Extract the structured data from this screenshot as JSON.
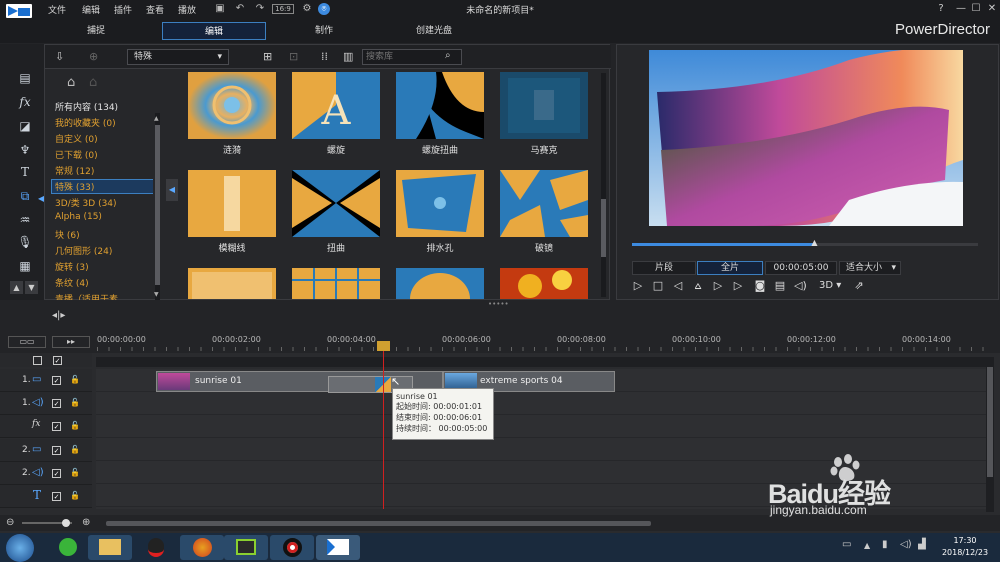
{
  "menu": {
    "items": [
      "文件",
      "编辑",
      "插件",
      "查看",
      "播放"
    ]
  },
  "window": {
    "title": "未命名的新项目*",
    "brand": "PowerDirector",
    "help": "?",
    "minimize": "—",
    "maximize": "☐",
    "close": "✕"
  },
  "mode_tabs": [
    "捕捉",
    "编辑",
    "制作",
    "创建光盘"
  ],
  "library": {
    "dropdown": "特殊",
    "search_placeholder": "搜索库",
    "categories": [
      {
        "label": "所有内容 (134)",
        "color": "white"
      },
      {
        "label": "我的收藏夹 (0)",
        "color": "orange"
      },
      {
        "label": "自定义 (0)",
        "color": "orange"
      },
      {
        "label": "已下载 (0)",
        "color": "orange"
      },
      {
        "label": "常规 (12)",
        "color": "orange"
      },
      {
        "label": "特殊 (33)",
        "color": "orange",
        "selected": true
      },
      {
        "label": "3D/类 3D (34)",
        "color": "orange"
      },
      {
        "label": "Alpha (15)",
        "color": "orange"
      },
      {
        "label": "块 (6)",
        "color": "orange"
      },
      {
        "label": "几何图形 (24)",
        "color": "orange"
      },
      {
        "label": "旋转 (3)",
        "color": "orange"
      },
      {
        "label": "条纹 (4)",
        "color": "orange"
      },
      {
        "label": "青播（适用于素",
        "color": "orange"
      }
    ],
    "transitions": [
      {
        "label": "涟漪"
      },
      {
        "label": "螺旋"
      },
      {
        "label": "螺旋扭曲"
      },
      {
        "label": "马赛克"
      },
      {
        "label": "模糊线"
      },
      {
        "label": "扭曲"
      },
      {
        "label": "排水孔"
      },
      {
        "label": "破镜"
      }
    ]
  },
  "preview": {
    "clip_btn": "片段",
    "movie_btn": "全片",
    "timecode": "00:00:05:00",
    "fit": "适合大小",
    "mode_3d": "3D",
    "progress": 0.53
  },
  "timeline": {
    "ruler": [
      "00:00:00:00",
      "00:00:02:00",
      "00:00:04:00",
      "00:00:06:00",
      "00:00:08:00",
      "00:00:10:00",
      "00:00:12:00",
      "00:00:14:00"
    ],
    "tracks": [
      {
        "label": "1.",
        "type": "video"
      },
      {
        "label": "1.",
        "type": "audio"
      },
      {
        "label": "",
        "type": "fx"
      },
      {
        "label": "2.",
        "type": "video"
      },
      {
        "label": "2.",
        "type": "audio"
      },
      {
        "label": "",
        "type": "title"
      },
      {
        "label": "",
        "type": "voice"
      }
    ],
    "clips": [
      {
        "name": "sunrise 01"
      },
      {
        "name": "extreme sports 04"
      }
    ],
    "tooltip": {
      "title": "sunrise 01",
      "start": "起始时间: 00:00:01:01",
      "end": "结束时间: 00:00:06:01",
      "duration": "持续时间： 00:00:05:00"
    }
  },
  "taskbar": {
    "time": "17:30",
    "date": "2018/12/23"
  },
  "watermark": {
    "brand": "Baidu经验",
    "url": "jingyan.baidu.com"
  }
}
